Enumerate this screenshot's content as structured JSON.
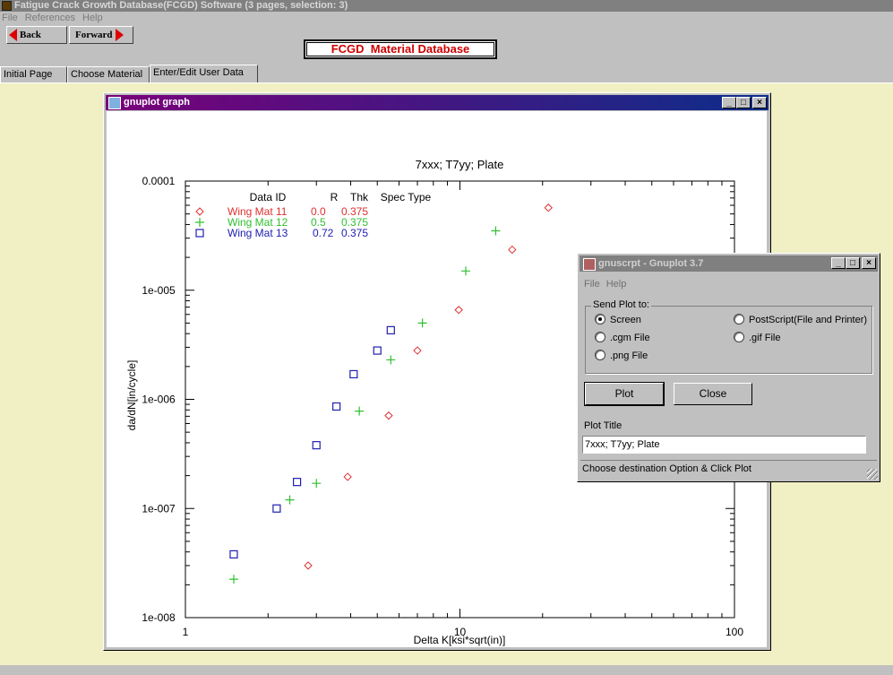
{
  "app": {
    "title": "Fatigue Crack Growth Database(FCGD) Software (3 pages, selection: 3)",
    "menu": [
      "File",
      "References",
      "Help"
    ],
    "back_label": "Back",
    "forward_label": "Forward",
    "banner": "FCGD  Material Database",
    "tabs": [
      "Initial Page",
      "Choose Material",
      "Enter/Edit User Data"
    ],
    "active_tab": "Enter/Edit User Data",
    "content_bg": "#f1f0c4"
  },
  "graph_window": {
    "title": "gnuplot graph",
    "buttons": [
      "_",
      "□",
      "×"
    ]
  },
  "chart_data": {
    "type": "scatter",
    "title": "7xxx; T7yy; Plate",
    "xlabel": "Delta K[ksi*sqrt(in)]",
    "ylabel": "da/dN[in/cycle]",
    "xscale": "log",
    "yscale": "log",
    "xlim": [
      1,
      100
    ],
    "ylim": [
      1e-08,
      0.0001
    ],
    "xticks": [
      "1",
      "10",
      "100"
    ],
    "yticks": [
      "1e-008",
      "1e-007",
      "1e-006",
      "1e-005",
      "0.0001"
    ],
    "legend": {
      "placement": "top-left",
      "header": [
        "Data ID",
        "R",
        "Thk",
        "Spec Type"
      ]
    },
    "series": [
      {
        "name": "Wing Mat 11",
        "R": "0.0",
        "Thk": "0.375",
        "color": "#e03030",
        "marker": "diamond",
        "points": [
          [
            2.8,
            3e-08
          ],
          [
            3.9,
            1.95e-07
          ],
          [
            5.5,
            7.1e-07
          ],
          [
            7.0,
            2.8e-06
          ],
          [
            9.9,
            6.6e-06
          ],
          [
            15.5,
            2.35e-05
          ],
          [
            21.0,
            5.7e-05
          ]
        ]
      },
      {
        "name": "Wing Mat 12",
        "R": "0.5",
        "Thk": "0.375",
        "color": "#30c030",
        "marker": "plus",
        "points": [
          [
            1.5,
            2.25e-08
          ],
          [
            2.4,
            1.2e-07
          ],
          [
            3.0,
            1.7e-07
          ],
          [
            4.3,
            7.8e-07
          ],
          [
            5.6,
            2.3e-06
          ],
          [
            7.3,
            5e-06
          ],
          [
            10.5,
            1.5e-05
          ],
          [
            13.5,
            3.5e-05
          ]
        ]
      },
      {
        "name": "Wing Mat 13",
        "R": "0.72",
        "Thk": "0.375",
        "color": "#2020b0",
        "marker": "square",
        "points": [
          [
            1.5,
            3.8e-08
          ],
          [
            2.15,
            1e-07
          ],
          [
            2.55,
            1.75e-07
          ],
          [
            3.0,
            3.8e-07
          ],
          [
            3.55,
            8.6e-07
          ],
          [
            4.1,
            1.7e-06
          ],
          [
            5.0,
            2.8e-06
          ],
          [
            5.6,
            4.3e-06
          ]
        ]
      }
    ]
  },
  "dialog": {
    "title": "gnuscrpt - Gnuplot 3.7",
    "menu": [
      "File",
      "Help"
    ],
    "group_label": "Send Plot to:",
    "options": [
      "Screen",
      "PostScript(File and Printer)",
      ".cgm File",
      ".gif File",
      ".png File"
    ],
    "selected": "Screen",
    "plot_button": "Plot",
    "close_button": "Close",
    "plot_title_label": "Plot Title",
    "plot_title_value": "7xxx; T7yy; Plate",
    "status": "Choose destination Option & Click Plot"
  }
}
